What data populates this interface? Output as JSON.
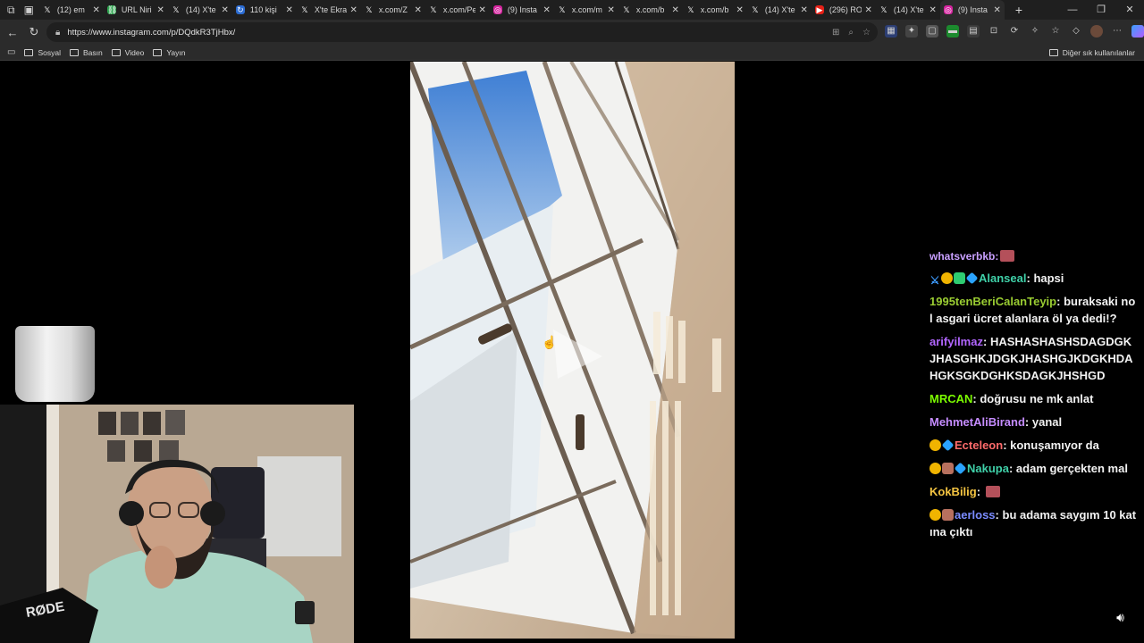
{
  "browser": {
    "tabs": [
      {
        "title": "(12) em",
        "icon": "x-logo"
      },
      {
        "title": "URL Niri",
        "icon": "link-icon"
      },
      {
        "title": "(14) X'te",
        "icon": "x-logo"
      },
      {
        "title": "110 kişi",
        "icon": "refresh-logo"
      },
      {
        "title": "X'te Ekra",
        "icon": "x-logo"
      },
      {
        "title": "x.com/Z",
        "icon": "x-logo"
      },
      {
        "title": "x.com/Pe",
        "icon": "x-logo"
      },
      {
        "title": "(9) Insta",
        "icon": "instagram-logo"
      },
      {
        "title": "x.com/m",
        "icon": "x-logo"
      },
      {
        "title": "x.com/b",
        "icon": "x-logo"
      },
      {
        "title": "x.com/b",
        "icon": "x-logo"
      },
      {
        "title": "(14) X'te",
        "icon": "x-logo"
      },
      {
        "title": "(296) RO",
        "icon": "youtube-logo"
      },
      {
        "title": "(14) X'te",
        "icon": "x-logo"
      },
      {
        "title": "(9) Insta",
        "icon": "instagram-logo",
        "active": true
      }
    ],
    "url": "https://www.instagram.com/p/DQdkR3TjHbx/",
    "bookmarks": [
      "Sosyal",
      "Basın",
      "Video",
      "Yayın"
    ],
    "other_bookmarks": "Diğer sık kullanılanlar"
  },
  "chat": {
    "partial_top": "whatsverbkb:",
    "messages": [
      {
        "badges": [
          "sword",
          "sub",
          "green",
          "cube"
        ],
        "user": "Alanseal",
        "color": "#3fd0a8",
        "text": "hapsi"
      },
      {
        "badges": [],
        "user": "1995tenBeriCalanTeyip",
        "color": "#9acd32",
        "text": "buraksaki nol asgari ücret alanlara öl ya dedi!?"
      },
      {
        "badges": [],
        "user": "arifyilmaz",
        "color": "#b266ff",
        "text": "HASHASHASHSDAGDGKJHASGHKJDGKJHASHGJKDGKHDAHGKSGKDGHKSDAGKJHSHGD"
      },
      {
        "badges": [],
        "user": "MRCAN",
        "color": "#7cfc00",
        "text": "doğrusu ne mk anlat"
      },
      {
        "badges": [],
        "user": "MehmetAliBirand",
        "color": "#c58cff",
        "text": "yanal"
      },
      {
        "badges": [
          "sub",
          "cube"
        ],
        "user": "Ecteleon",
        "color": "#ff6b6b",
        "text": "konuşamıyor da"
      },
      {
        "badges": [
          "sub",
          "img",
          "cube"
        ],
        "user": "Nakupa",
        "color": "#3fd0a8",
        "text": "adam gerçekten mal"
      },
      {
        "badges": [],
        "user": "KokBilig",
        "color": "#f5c542",
        "text": "",
        "emote": true
      },
      {
        "badges": [
          "sub",
          "img"
        ],
        "user": "aerloss",
        "color": "#7b8cff",
        "text": "bu adama saygım 10 katına çıktı"
      }
    ]
  }
}
